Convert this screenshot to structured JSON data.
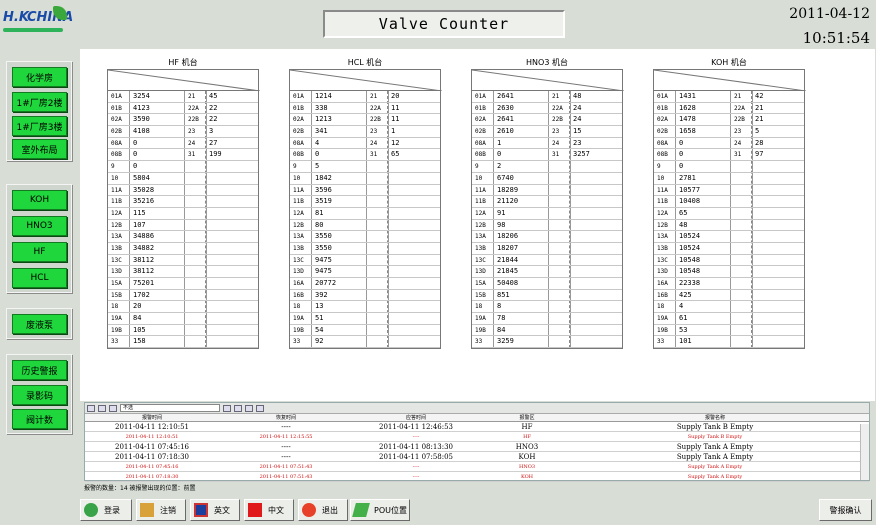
{
  "logo": {
    "hk": "H.K",
    "china": "CHINA"
  },
  "header": {
    "title": "Valve Counter",
    "date": "2011-04-12",
    "time": "10:51:54"
  },
  "nav": {
    "g1": [
      "化学房",
      "1#厂房2楼",
      "1#厂房3楼",
      "室外布局"
    ],
    "g2": [
      "KOH",
      "HNO3",
      "HF",
      "HCL"
    ],
    "g3": [
      "废液泵"
    ],
    "g4": [
      "历史警报",
      "录影码",
      "阀计数"
    ]
  },
  "machines": [
    {
      "title": "HF 机台",
      "left": [
        [
          "01A",
          "3254"
        ],
        [
          "01B",
          "4123"
        ],
        [
          "02A",
          "3590"
        ],
        [
          "02B",
          "4108"
        ],
        [
          "08A",
          "0"
        ],
        [
          "08B",
          "0"
        ],
        [
          "9",
          "0"
        ],
        [
          "10",
          "5804"
        ],
        [
          "11A",
          "35028"
        ],
        [
          "11B",
          "35216"
        ],
        [
          "12A",
          "115"
        ],
        [
          "12B",
          "107"
        ],
        [
          "13A",
          "34886"
        ],
        [
          "13B",
          "34882"
        ],
        [
          "13C",
          "38112"
        ],
        [
          "13D",
          "38112"
        ],
        [
          "15A",
          "75201"
        ],
        [
          "15B",
          "1702"
        ],
        [
          "18",
          "20"
        ],
        [
          "19A",
          "84"
        ],
        [
          "19B",
          "105"
        ],
        [
          "33",
          "158"
        ]
      ],
      "right": [
        [
          "21",
          "45"
        ],
        [
          "22A",
          "22"
        ],
        [
          "22B",
          "22"
        ],
        [
          "23",
          "3"
        ],
        [
          "24",
          "27"
        ],
        [
          "31",
          "199"
        ]
      ]
    },
    {
      "title": "HCL 机台",
      "left": [
        [
          "01A",
          "1214"
        ],
        [
          "01B",
          "338"
        ],
        [
          "02A",
          "1213"
        ],
        [
          "02B",
          "341"
        ],
        [
          "08A",
          "4"
        ],
        [
          "08B",
          "0"
        ],
        [
          "9",
          "5"
        ],
        [
          "10",
          "1842"
        ],
        [
          "11A",
          "3596"
        ],
        [
          "11B",
          "3519"
        ],
        [
          "12A",
          "81"
        ],
        [
          "12B",
          "80"
        ],
        [
          "13A",
          "3550"
        ],
        [
          "13B",
          "3550"
        ],
        [
          "13C",
          "9475"
        ],
        [
          "13D",
          "9475"
        ],
        [
          "16A",
          "20772"
        ],
        [
          "16B",
          "392"
        ],
        [
          "18",
          "13"
        ],
        [
          "19A",
          "51"
        ],
        [
          "19B",
          "54"
        ],
        [
          "33",
          "92"
        ]
      ],
      "right": [
        [
          "21",
          "20"
        ],
        [
          "22A",
          "11"
        ],
        [
          "22B",
          "11"
        ],
        [
          "23",
          "1"
        ],
        [
          "24",
          "12"
        ],
        [
          "31",
          "65"
        ]
      ]
    },
    {
      "title": "HNO3 机台",
      "left": [
        [
          "01A",
          "2641"
        ],
        [
          "01B",
          "2630"
        ],
        [
          "02A",
          "2641"
        ],
        [
          "02B",
          "2610"
        ],
        [
          "08A",
          "1"
        ],
        [
          "08B",
          "0"
        ],
        [
          "9",
          "2"
        ],
        [
          "10",
          "6740"
        ],
        [
          "11A",
          "18289"
        ],
        [
          "11B",
          "21120"
        ],
        [
          "12A",
          "91"
        ],
        [
          "12B",
          "98"
        ],
        [
          "13A",
          "18206"
        ],
        [
          "13B",
          "18207"
        ],
        [
          "13C",
          "21844"
        ],
        [
          "13D",
          "21845"
        ],
        [
          "15A",
          "50408"
        ],
        [
          "15B",
          "851"
        ],
        [
          "18",
          "8"
        ],
        [
          "19A",
          "78"
        ],
        [
          "19B",
          "84"
        ],
        [
          "33",
          "3259"
        ]
      ],
      "right": [
        [
          "21",
          "48"
        ],
        [
          "22A",
          "24"
        ],
        [
          "22B",
          "24"
        ],
        [
          "23",
          "15"
        ],
        [
          "24",
          "23"
        ],
        [
          "31",
          "3257"
        ]
      ]
    },
    {
      "title": "KOH 机台",
      "left": [
        [
          "01A",
          "1431"
        ],
        [
          "01B",
          "1628"
        ],
        [
          "02A",
          "1478"
        ],
        [
          "02B",
          "1658"
        ],
        [
          "08A",
          "0"
        ],
        [
          "08B",
          "0"
        ],
        [
          "9",
          "0"
        ],
        [
          "10",
          "2781"
        ],
        [
          "11A",
          "10577"
        ],
        [
          "11B",
          "10408"
        ],
        [
          "12A",
          "65"
        ],
        [
          "12B",
          "48"
        ],
        [
          "13A",
          "10524"
        ],
        [
          "13B",
          "10524"
        ],
        [
          "13C",
          "10548"
        ],
        [
          "13D",
          "10548"
        ],
        [
          "16A",
          "22338"
        ],
        [
          "16B",
          "425"
        ],
        [
          "18",
          "4"
        ],
        [
          "19A",
          "61"
        ],
        [
          "19B",
          "53"
        ],
        [
          "33",
          "101"
        ]
      ],
      "right": [
        [
          "21",
          "42"
        ],
        [
          "22A",
          "21"
        ],
        [
          "22B",
          "21"
        ],
        [
          "23",
          "5"
        ],
        [
          "24",
          "28"
        ],
        [
          "31",
          "97"
        ]
      ]
    }
  ],
  "alarm": {
    "filter": "不选",
    "headers": [
      "报警时间",
      "恢复时间",
      "应答时间",
      "报警区",
      "报警名称"
    ],
    "rows": [
      {
        "t": "2011-04-11 12:10:51",
        "r": "----",
        "a": "2011-04-11 12:46:53",
        "z": "HF",
        "n": "Supply Tank B Empty",
        "red": false
      },
      {
        "t": "2011-04-11 12:10:51",
        "r": "2011-04-11 12:15:55",
        "a": "----",
        "z": "HF",
        "n": "Supply Tank B Empty",
        "red": true
      },
      {
        "t": "2011-04-11 07:45:16",
        "r": "----",
        "a": "2011-04-11 08:13:30",
        "z": "HNO3",
        "n": "Supply Tank A Empty",
        "red": false
      },
      {
        "t": "2011-04-11 07:18:30",
        "r": "----",
        "a": "2011-04-11 07:58:05",
        "z": "KOH",
        "n": "Supply Tank A Empty",
        "red": false
      },
      {
        "t": "2011-04-11 07:45:16",
        "r": "2011-04-11 07:51:43",
        "a": "----",
        "z": "HNO3",
        "n": "Supply Tank A Empty",
        "red": true
      },
      {
        "t": "2011-04-11 07:18:30",
        "r": "2011-04-11 07:51:43",
        "a": "----",
        "z": "KOH",
        "n": "Supply Tank A Empty",
        "red": true
      }
    ],
    "status": "报警的数量：14  被报警出现的位置：前置"
  },
  "bottom": {
    "login": "登录",
    "logout": "注销",
    "english": "英文",
    "chinese": "中文",
    "exit": "退出",
    "pou": "POU位置",
    "ack": "警报确认"
  }
}
